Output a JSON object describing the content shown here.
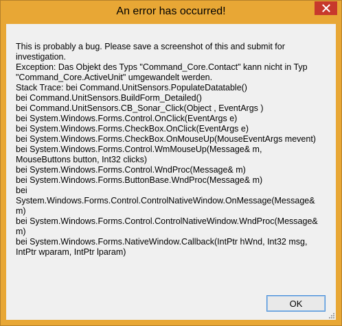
{
  "window": {
    "title": "An error has occurred!",
    "close_icon": "close-icon",
    "accent_color": "#e8a735",
    "close_color": "#c7392c"
  },
  "message": {
    "lines": [
      "This is probably a bug. Please save a screenshot of this and submit for investigation.",
      "Exception: Das Objekt des Typs \"Command_Core.Contact\" kann nicht in Typ \"Command_Core.ActiveUnit\" umgewandelt werden.",
      "Stack Trace:    bei Command.UnitSensors.PopulateDatatable()",
      "   bei Command.UnitSensors.BuildForm_Detailed()",
      "   bei Command.UnitSensors.CB_Sonar_Click(Object , EventArgs )",
      "   bei System.Windows.Forms.Control.OnClick(EventArgs e)",
      "   bei System.Windows.Forms.CheckBox.OnClick(EventArgs e)",
      "   bei System.Windows.Forms.CheckBox.OnMouseUp(MouseEventArgs mevent)",
      "   bei System.Windows.Forms.Control.WmMouseUp(Message& m, MouseButtons button, Int32 clicks)",
      "   bei System.Windows.Forms.Control.WndProc(Message& m)",
      "   bei System.Windows.Forms.ButtonBase.WndProc(Message& m)",
      "   bei System.Windows.Forms.Control.ControlNativeWindow.OnMessage(Message& m)",
      "   bei System.Windows.Forms.Control.ControlNativeWindow.WndProc(Message& m)",
      "   bei System.Windows.Forms.NativeWindow.Callback(IntPtr hWnd, Int32 msg, IntPtr wparam, IntPtr lparam)"
    ]
  },
  "buttons": {
    "ok_label": "OK"
  }
}
